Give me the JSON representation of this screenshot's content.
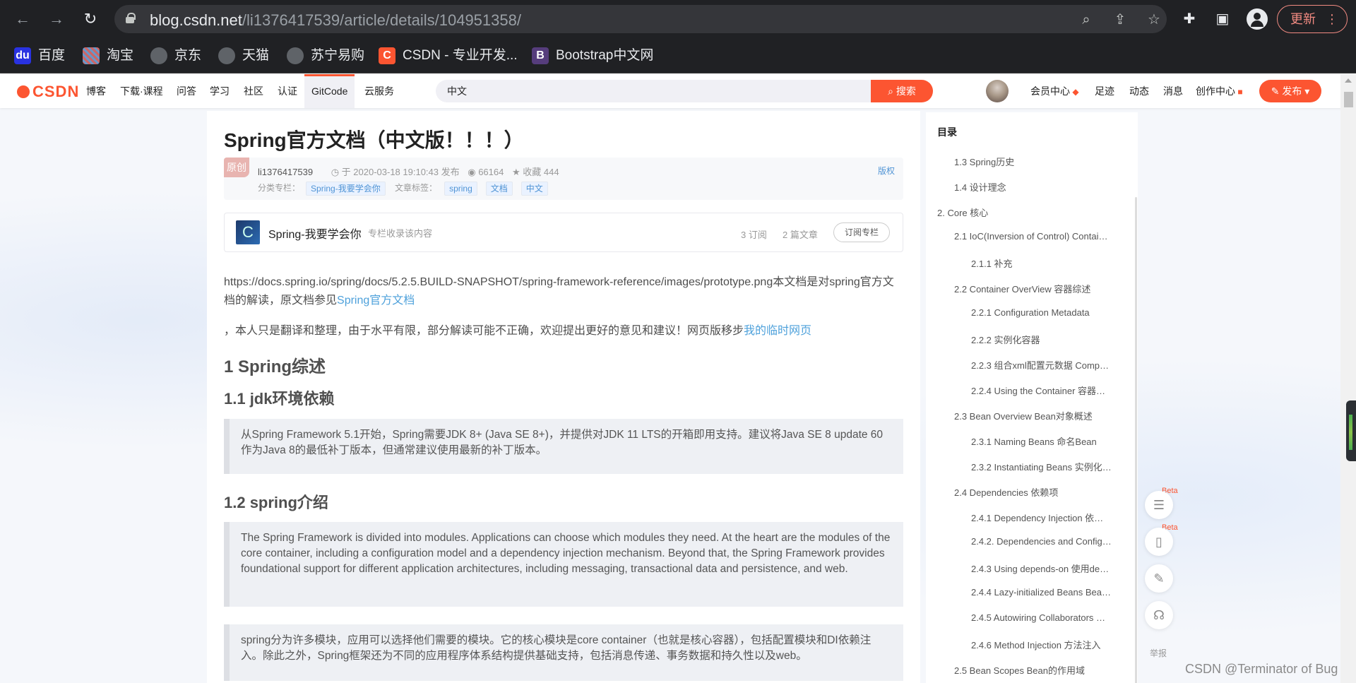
{
  "browser": {
    "url_host": "blog.csdn.net",
    "url_path": "/li1376417539/article/details/104951358/",
    "update_label": "更新",
    "bookmarks": [
      {
        "label": "百度",
        "icon": "baidu-icon"
      },
      {
        "label": "淘宝",
        "icon": "taobao-icon"
      },
      {
        "label": "京东",
        "icon": "globe-icon"
      },
      {
        "label": "天猫",
        "icon": "globe-icon"
      },
      {
        "label": "苏宁易购",
        "icon": "globe-icon"
      },
      {
        "label": "CSDN - 专业开发...",
        "icon": "csdn-icon"
      },
      {
        "label": "Bootstrap中文网",
        "icon": "bootstrap-icon"
      }
    ]
  },
  "csdn_nav": {
    "logo": "CSDN",
    "items": [
      "博客",
      "下载·课程",
      "问答",
      "学习",
      "社区",
      "认证",
      "GitCode",
      "云服务"
    ],
    "search_value": "中文",
    "search_button": "搜索",
    "right_items": [
      "会员中心",
      "足迹",
      "动态",
      "消息",
      "创作中心"
    ],
    "publish_button": "发布"
  },
  "article": {
    "title": "Spring官方文档（中文版！！！）",
    "badge": "原创",
    "author": "li1376417539",
    "publish_time": "于 2020-03-18 19:10:43 发布",
    "views": "66164",
    "favorites": "收藏 444",
    "copyright": "版权",
    "category_label": "分类专栏：",
    "category": "Spring-我要学会你",
    "tags_label": "文章标签：",
    "tags": [
      "spring",
      "文档",
      "中文"
    ],
    "column": {
      "name": "Spring-我要学会你",
      "desc": "专栏收录该内容",
      "subscriptions": "3 订阅",
      "articles": "2 篇文章",
      "subscribe_button": "订阅专栏"
    },
    "intro_text": "https://docs.spring.io/spring/docs/5.2.5.BUILD-SNAPSHOT/spring-framework-reference/images/prototype.png本文档是对spring官方文档的解读，原文档参见",
    "intro_link": "Spring官方文档",
    "note_text": "，本人只是翻译和整理，由于水平有限，部分解读可能不正确，欢迎提出更好的意见和建议！网页版移步",
    "note_link": "我的临时网页",
    "h_1": "1 Spring综述",
    "h_1_1": "1.1 jdk环境依赖",
    "quote_1": "从Spring Framework 5.1开始，Spring需要JDK 8+ (Java SE 8+)，并提供对JDK 11 LTS的开箱即用支持。建议将Java SE 8 update 60作为Java 8的最低补丁版本，但通常建议使用最新的补丁版本。",
    "h_1_2": "1.2 spring介绍",
    "quote_2": "The Spring Framework is divided into modules. Applications can choose which modules they need. At the heart are the modules of the core container, including a configuration model and a dependency injection mechanism. Beyond that, the Spring Framework provides foundational support for different application architectures, including messaging, transactional data and persistence, and web.",
    "quote_3": "spring分为许多模块，应用可以选择他们需要的模块。它的核心模块是core container（也就是核心容器），包括配置模块和DI依赖注入。除此之外，Spring框架还为不同的应用程序体系结构提供基础支持，包括消息传递、事务数据和持久性以及web。"
  },
  "toc": {
    "title": "目录",
    "items": [
      "1.3 Spring历史",
      "1.4 设计理念",
      "2. Core 核心",
      "2.1 IoC(Inversion of Control) Contai…",
      "2.1.1 补充",
      "2.2 Container OverView 容器综述",
      "2.2.1 Configuration Metadata",
      "2.2.2 实例化容器",
      "2.2.3 组合xml配置元数据 Comp…",
      "2.2.4 Using the Container 容器…",
      "2.3 Bean Overview Bean对象概述",
      "2.3.1 Naming Beans 命名Bean",
      "2.3.2 Instantiating Beans 实例化…",
      "2.4 Dependencies 依赖项",
      "2.4.1 Dependency Injection 依…",
      "2.4.2. Dependencies and Config…",
      "2.4.3 Using depends-on 使用de…",
      "2.4.4 Lazy-initialized Beans Bea…",
      "2.4.5 Autowiring Collaborators …",
      "2.4.6 Method Injection 方法注入",
      "2.5 Bean Scopes Bean的作用域"
    ]
  },
  "side_tools": {
    "beta": "Beta",
    "report": "举报"
  },
  "watermark": "CSDN @Terminator of Bug"
}
